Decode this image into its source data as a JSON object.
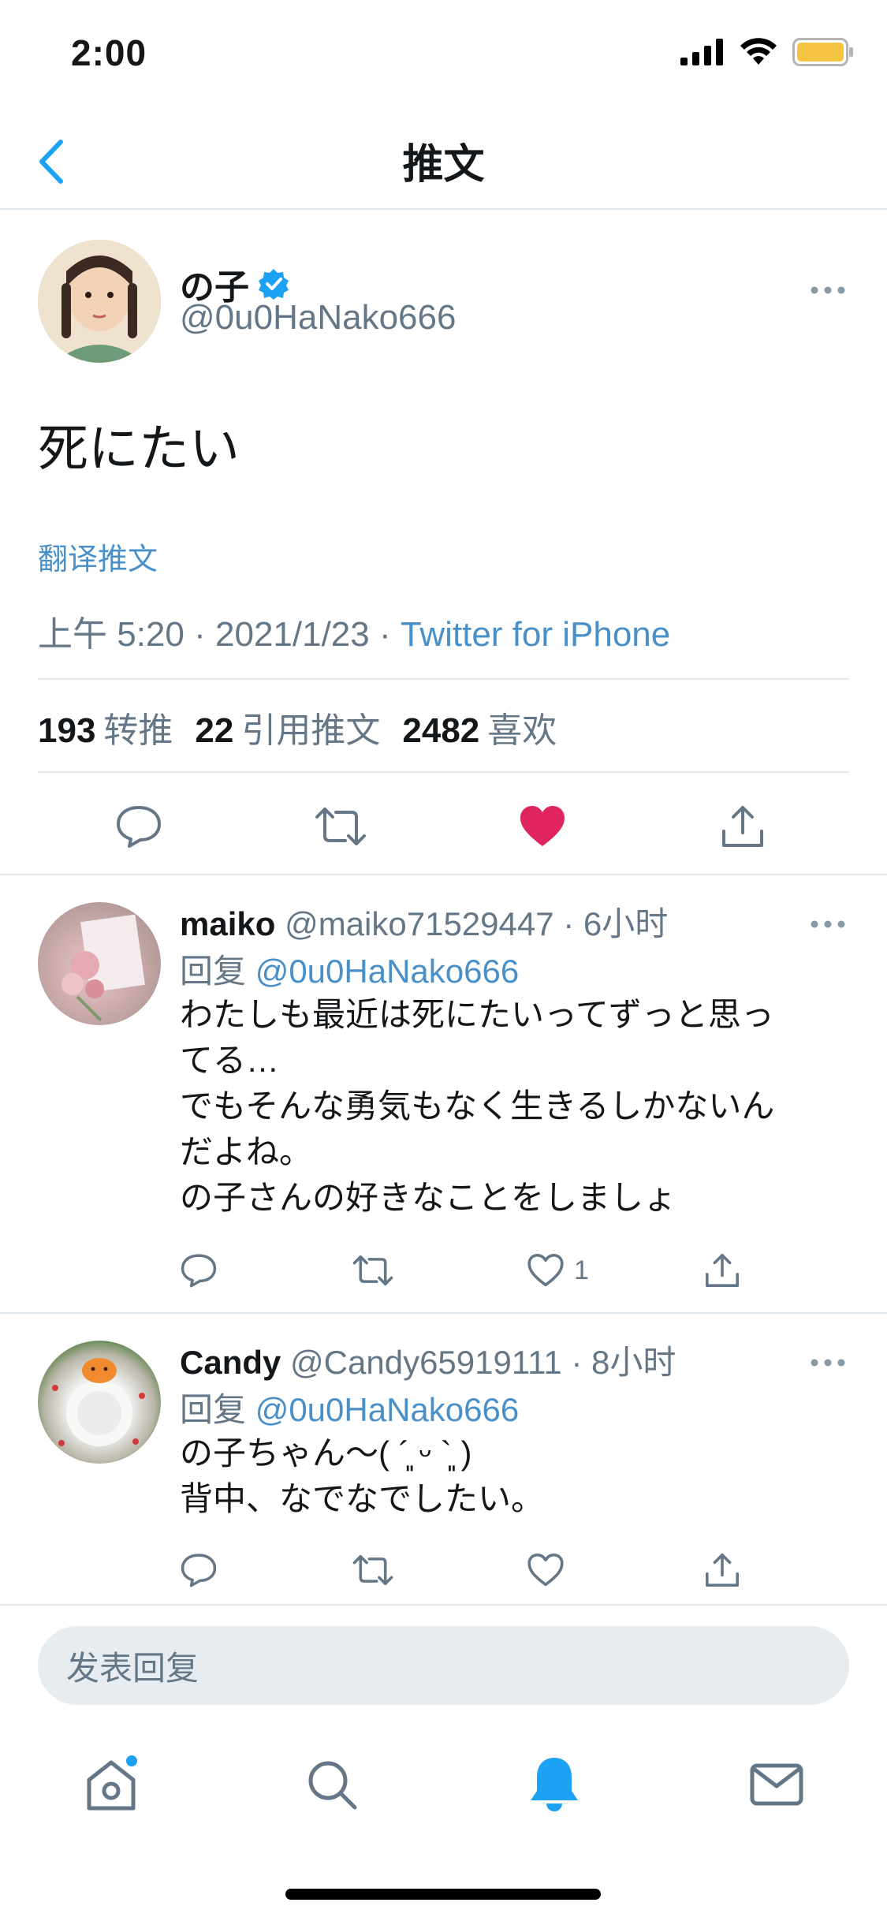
{
  "status_bar": {
    "time": "2:00"
  },
  "nav": {
    "title": "推文"
  },
  "tweet": {
    "author_name": "の子",
    "author_handle": "@0u0HaNako666",
    "text": "死にたい",
    "translate_label": "翻译推文",
    "time": "上午 5:20",
    "date": "2021/1/23",
    "separator": "·",
    "source": "Twitter for iPhone",
    "retweets_count": "193",
    "retweets_label": "转推",
    "quotes_count": "22",
    "quotes_label": "引用推文",
    "likes_count": "2482",
    "likes_label": "喜欢",
    "liked": true,
    "like_color": "#e0245e"
  },
  "replies": [
    {
      "name": "maiko",
      "handle": "@maiko71529447",
      "time": "· 6小时",
      "reply_prefix": "回复",
      "reply_to": "@0u0HaNako666",
      "lines": [
        "わたしも最近は死にたいってずっと思っ",
        "てる…",
        "でもそんな勇気もなく生きるしかないん",
        "だよね。",
        "の子さんの好きなことをしましょ"
      ],
      "like_count": "1"
    },
    {
      "name": "Candy",
      "handle": "@Candy65919111",
      "time": "· 8小时",
      "reply_prefix": "回复",
      "reply_to": "@0u0HaNako666",
      "lines": [
        "の子ちゃん～( ´͈ ᵕ `͈ )",
        "背中、なでなでしたい。"
      ],
      "like_count": ""
    }
  ],
  "compose": {
    "placeholder": "发表回复"
  },
  "tabs": [
    "home-icon",
    "search-icon",
    "notifications-icon",
    "messages-icon"
  ],
  "colors": {
    "accent": "#1da1f2",
    "link": "#4a90c8",
    "like": "#e0245e",
    "battery": "#f5c542"
  }
}
